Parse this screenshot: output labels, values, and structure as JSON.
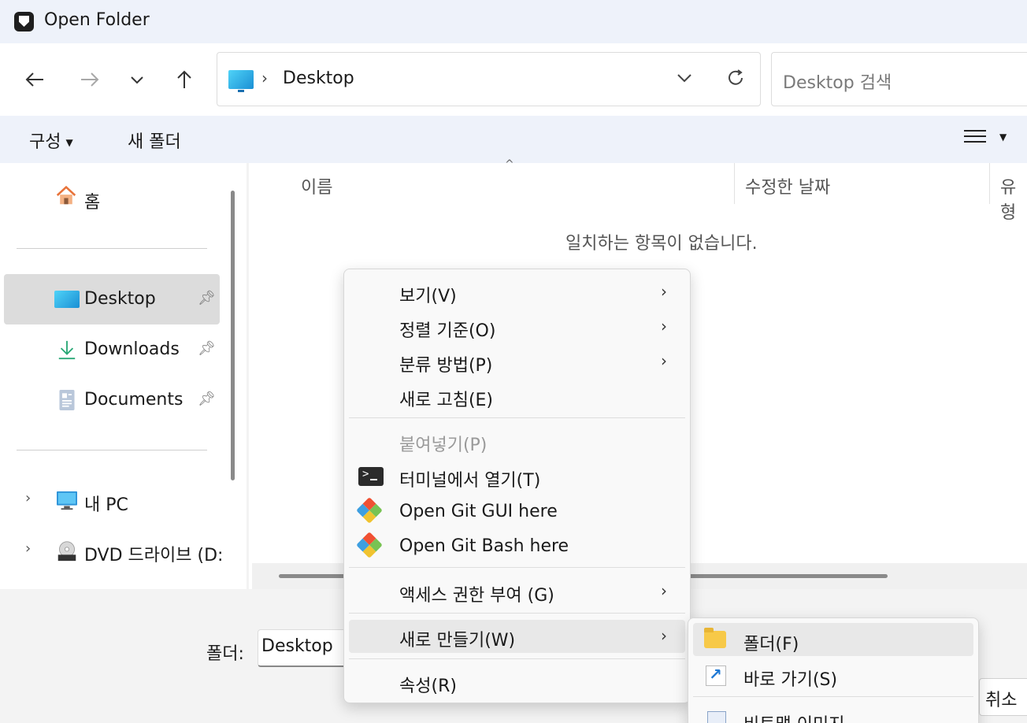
{
  "window": {
    "title": "Open Folder"
  },
  "nav": {
    "back_icon": "arrow-left-icon",
    "forward_icon": "arrow-right-icon",
    "recent_icon": "chevron-down-icon",
    "up_icon": "arrow-up-icon",
    "address": {
      "separator": "›",
      "location": "Desktop"
    },
    "search_placeholder": "Desktop 검색"
  },
  "commandbar": {
    "organize": "구성",
    "new_folder": "새 폴더"
  },
  "sidebar": {
    "home": "홈",
    "pinned": [
      {
        "label": "Desktop",
        "selected": true
      },
      {
        "label": "Downloads",
        "selected": false
      },
      {
        "label": "Documents",
        "selected": false
      }
    ],
    "this_pc": "내 PC",
    "dvd": "DVD 드라이브 (D:"
  },
  "columns": {
    "name": "이름",
    "modified": "수정한 날짜",
    "type": "유형"
  },
  "empty_message": "일치하는 항목이 없습니다.",
  "footer": {
    "folder_label": "폴더:",
    "folder_value": "Desktop",
    "cancel": "취소"
  },
  "context_menu": {
    "view": "보기(V)",
    "sort": "정렬 기준(O)",
    "group": "분류 방법(P)",
    "refresh": "새로 고침(E)",
    "paste": "붙여넣기(P)",
    "terminal": "터미널에서 열기(T)",
    "git_gui": "Open Git GUI here",
    "git_bash": "Open Git Bash here",
    "access": "액세스 권한 부여 (G)",
    "new": "새로 만들기(W)",
    "properties": "속성(R)"
  },
  "submenu": {
    "folder": "폴더(F)",
    "shortcut": "바로 가기(S)",
    "bitmap": "비트맵 이미지"
  },
  "colors": {
    "accent": "#1e78d4",
    "titlebar": "#eef2fa",
    "selected": "#dcdcdc"
  }
}
